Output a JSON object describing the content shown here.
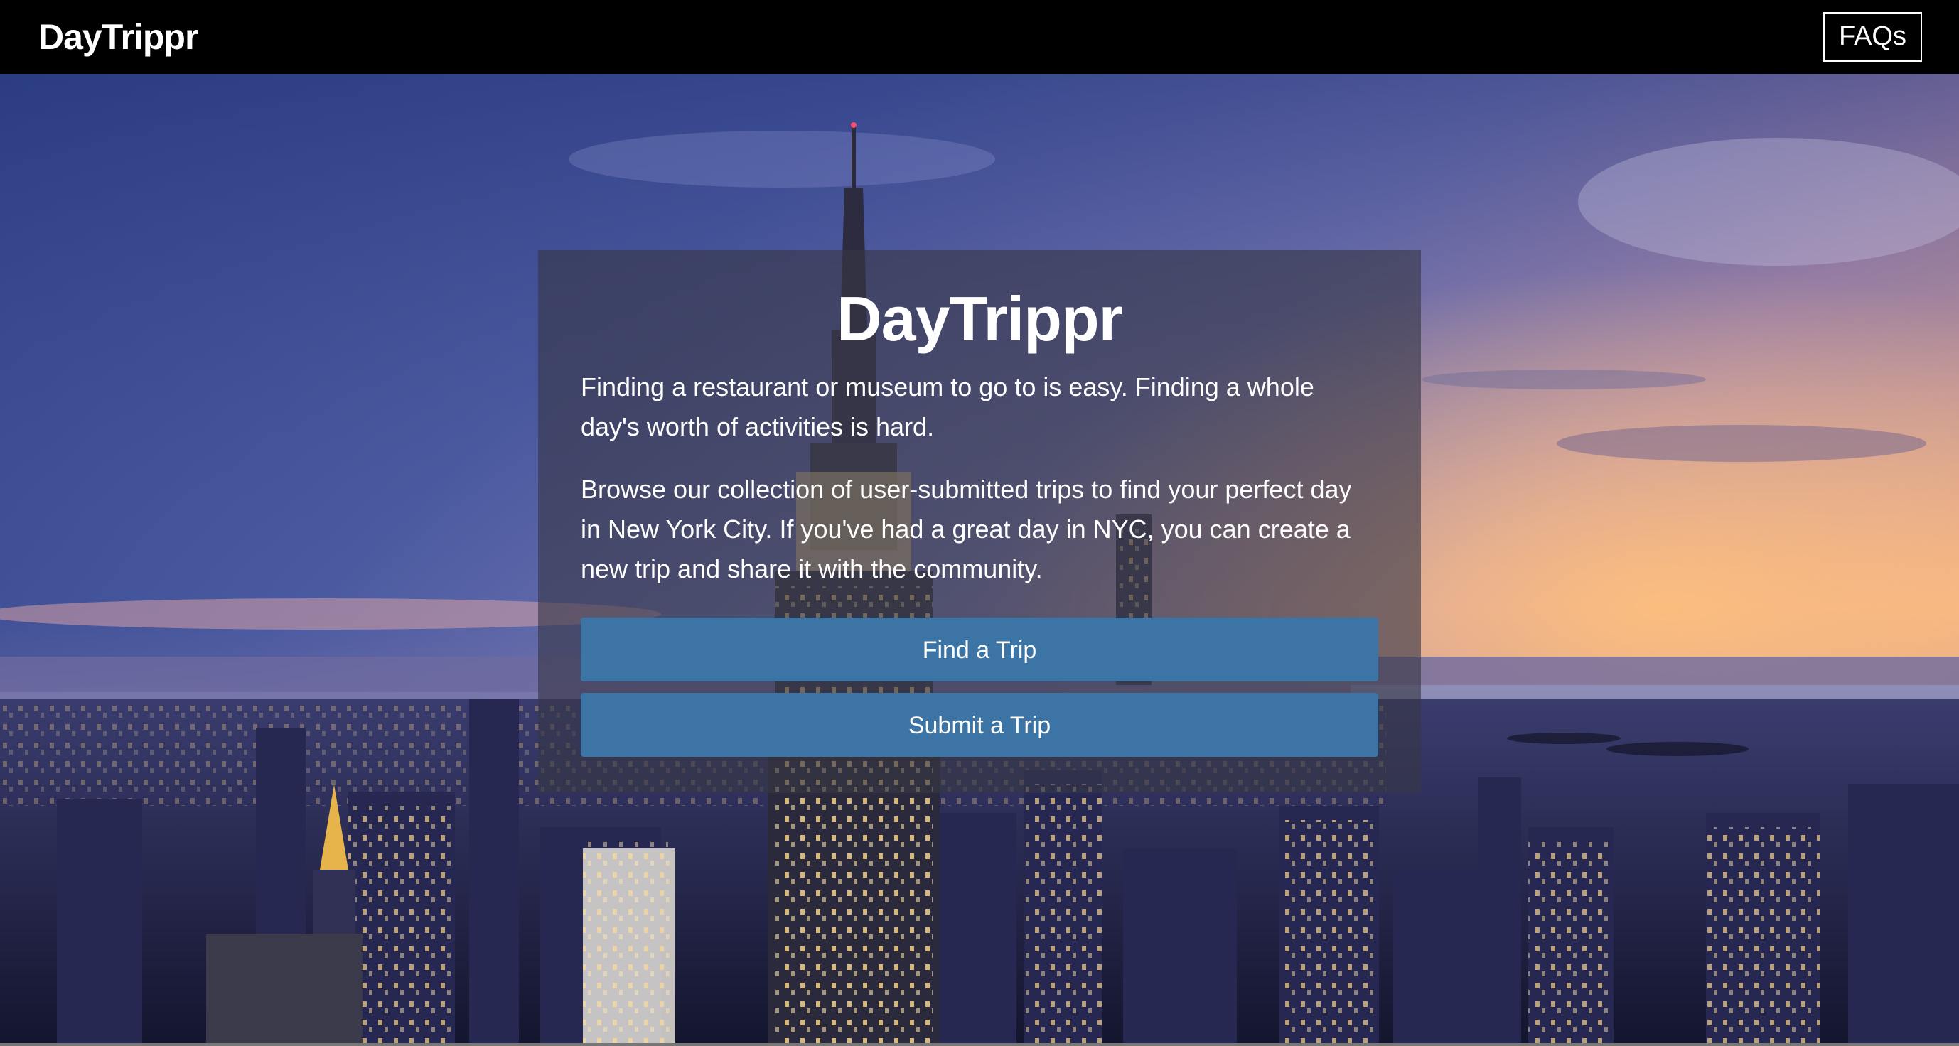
{
  "navbar": {
    "brand": "DayTrippr",
    "faq_label": "FAQs"
  },
  "hero": {
    "title": "DayTrippr",
    "paragraph_1": "Finding a restaurant or museum to go to is easy. Finding a whole day's worth of activities is hard.",
    "paragraph_2": "Browse our collection of user-submitted trips to find your perfect day in New York City. If you've had a great day in NYC, you can create a new trip and share it with the community.",
    "find_button": "Find a Trip",
    "submit_button": "Submit a Trip"
  },
  "colors": {
    "navbar_bg": "#000000",
    "button_bg": "#3d74a6",
    "card_overlay": "rgba(55,55,70,0.62)"
  }
}
